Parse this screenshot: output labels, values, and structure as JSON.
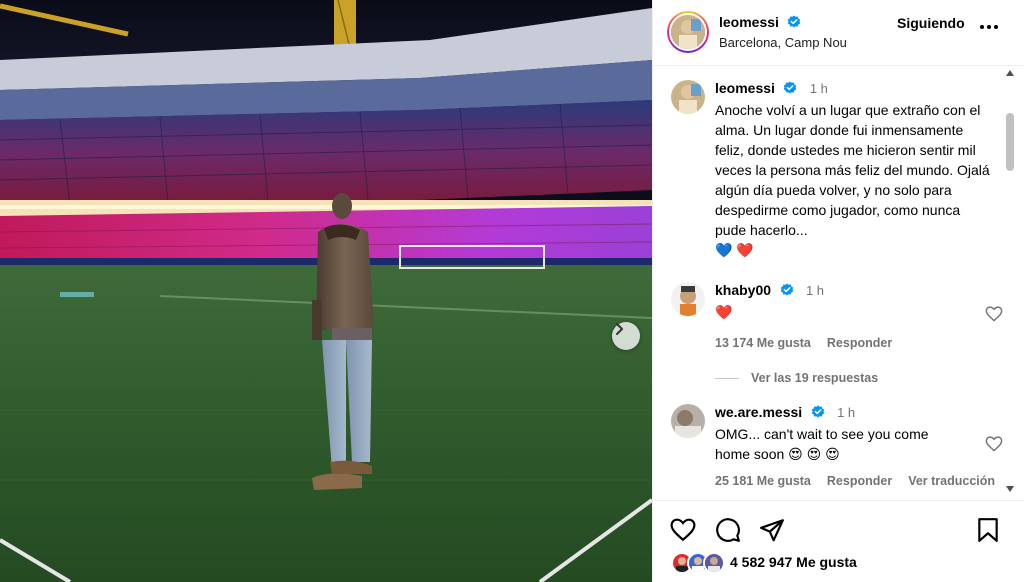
{
  "post": {
    "username": "leomessi",
    "location": "Barcelona, Camp Nou",
    "follow_label": "Siguiendo",
    "caption_time": "1 h",
    "caption": "Anoche volví a un lugar que extraño con el alma. Un lugar donde fui inmensamente feliz, donde ustedes me hicieron sentir mil veces la persona más feliz del mundo. Ojalá algún día pueda volver, y no solo para despedirme como jugador, como nunca pude hacerlo...",
    "caption_emoji": "💙 ❤️",
    "likes": "4 582 947 Me gusta"
  },
  "comments": [
    {
      "username": "khaby00",
      "time": "1 h",
      "text": "❤️",
      "likes": "13 174 Me gusta",
      "reply": "Responder",
      "view_replies": "Ver las 19 respuestas"
    },
    {
      "username": "we.are.messi",
      "time": "1 h",
      "text": "OMG... can't wait to see you come home soon 😍 😍 😍",
      "likes": "25 181 Me gusta",
      "reply": "Responder",
      "translate": "Ver traducción"
    }
  ],
  "icons": {
    "verified": "verified-badge-icon",
    "more": "more-options-icon",
    "next": "chevron-right-icon",
    "like": "heart-icon",
    "comment": "comment-icon",
    "share": "share-icon",
    "save": "bookmark-icon"
  },
  "colors": {
    "verified": "#0095f6",
    "heart_red": "#ff3040",
    "secondary_text": "#737373",
    "divider": "#efefef"
  }
}
